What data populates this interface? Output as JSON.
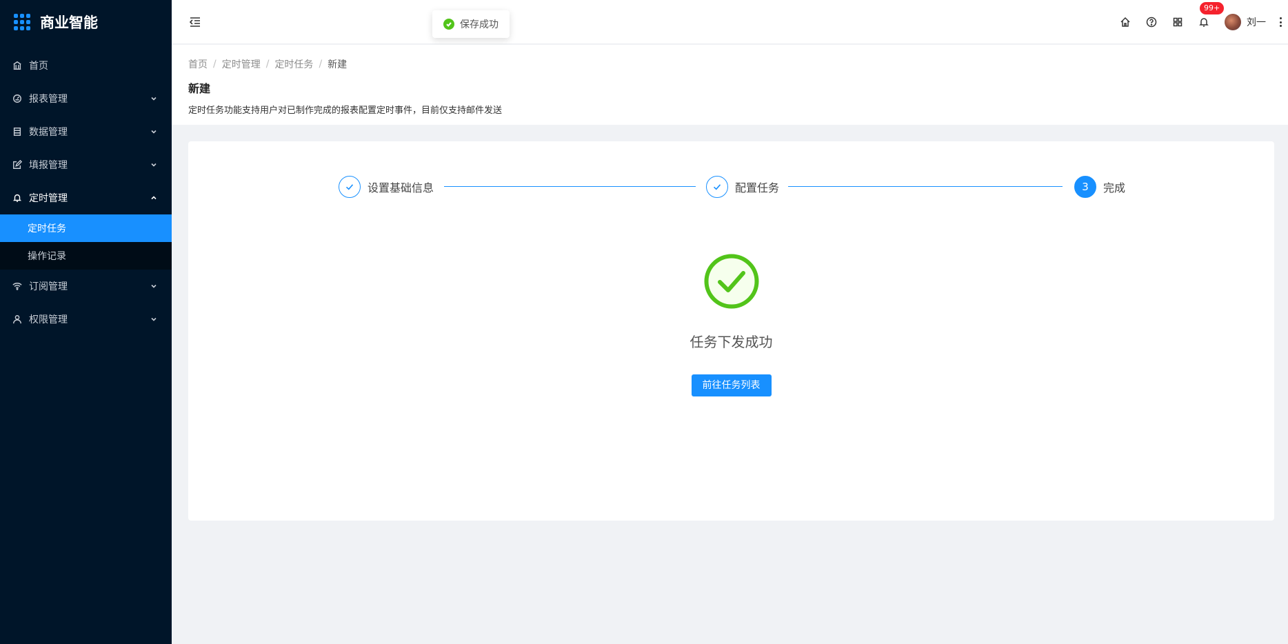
{
  "app": {
    "title": "商业智能"
  },
  "sidebar": {
    "items": [
      {
        "label": "首页",
        "icon": "bank-icon",
        "expandable": false
      },
      {
        "label": "报表管理",
        "icon": "dashboard-icon",
        "expandable": true
      },
      {
        "label": "数据管理",
        "icon": "table-icon",
        "expandable": true
      },
      {
        "label": "填报管理",
        "icon": "edit-icon",
        "expandable": true
      },
      {
        "label": "定时管理",
        "icon": "bell-icon",
        "expandable": true,
        "open": true,
        "children": [
          {
            "label": "定时任务",
            "active": true
          },
          {
            "label": "操作记录",
            "active": false
          }
        ]
      },
      {
        "label": "订阅管理",
        "icon": "wifi-icon",
        "expandable": true
      },
      {
        "label": "权限管理",
        "icon": "user-icon",
        "expandable": true
      }
    ]
  },
  "header": {
    "toast": "保存成功",
    "notification_badge": "99+",
    "user_name": "刘一"
  },
  "breadcrumb": [
    "首页",
    "定时管理",
    "定时任务",
    "新建"
  ],
  "page": {
    "title": "新建",
    "description": "定时任务功能支持用户对已制作完成的报表配置定时事件，目前仅支持邮件发送"
  },
  "steps": [
    {
      "label": "设置基础信息",
      "status": "finish"
    },
    {
      "label": "配置任务",
      "status": "finish"
    },
    {
      "label": "完成",
      "status": "process",
      "number": "3"
    }
  ],
  "result": {
    "title": "任务下发成功",
    "button_label": "前往任务列表"
  },
  "colors": {
    "sidebar_bg": "#001529",
    "primary": "#1890ff",
    "success": "#52c41a",
    "badge": "#f5222d"
  }
}
